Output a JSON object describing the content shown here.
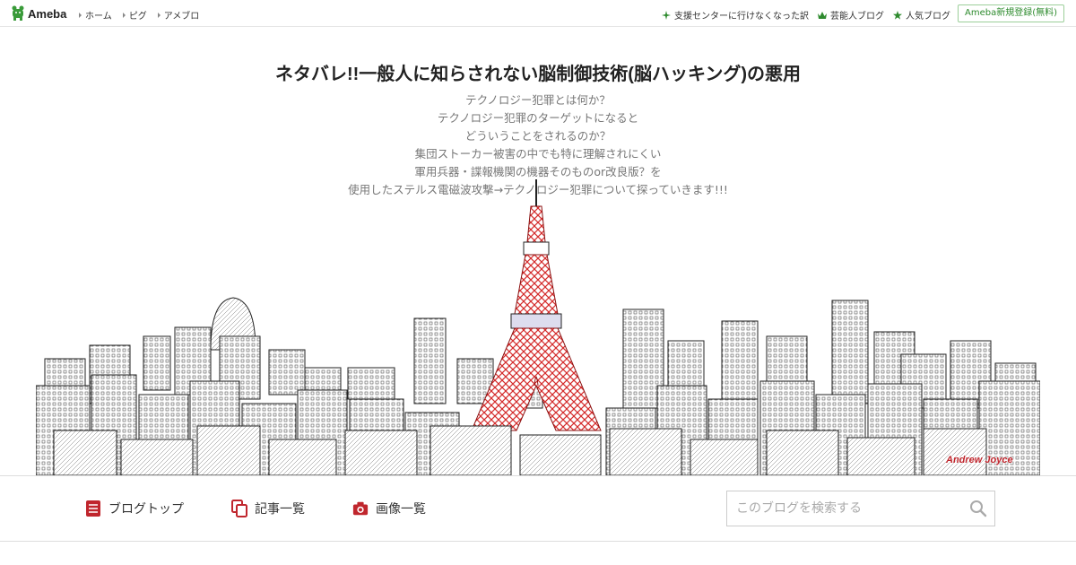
{
  "topbar": {
    "logo_text": "Ameba",
    "nav": [
      {
        "label": "ホーム"
      },
      {
        "label": "ピグ"
      },
      {
        "label": "アメブロ"
      }
    ],
    "links": [
      {
        "label": "支援センターに行けなくなった訳",
        "icon": "clover-icon"
      },
      {
        "label": "芸能人ブログ",
        "icon": "crown-icon"
      },
      {
        "label": "人気ブログ",
        "icon": "star-icon"
      }
    ],
    "register_label": "Ameba新規登録(無料)"
  },
  "header": {
    "title": "ネタバレ!!一般人に知らされない脳制御技術(脳ハッキング)の悪用",
    "description": [
      "テクノロジー犯罪とは何か？",
      "テクノロジー犯罪のターゲットになると",
      "どういうことをされるのか？",
      "集団ストーカー被害の中でも特に理解されにくい",
      "軍用兵器・諜報機関の機器そのものor改良版？を",
      "使用したステルス電磁波攻撃→テクノロジー犯罪について探っていきます!!!"
    ],
    "image_credit": "Andrew Joyce"
  },
  "blognav": {
    "items": [
      {
        "label": "ブログトップ",
        "icon": "document-icon"
      },
      {
        "label": "記事一覧",
        "icon": "copy-icon"
      },
      {
        "label": "画像一覧",
        "icon": "camera-icon"
      }
    ],
    "search_placeholder": "このブログを検索する"
  },
  "colors": {
    "accent_red": "#c0262d",
    "ameba_green": "#2e8b2e",
    "tower_red": "#d42a2a"
  }
}
